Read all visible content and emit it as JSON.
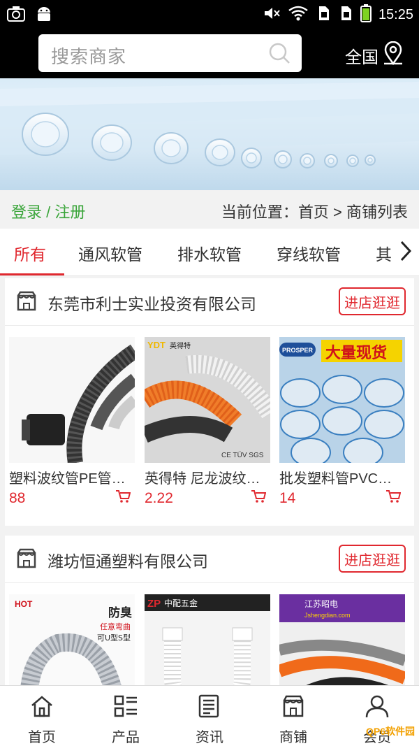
{
  "status_bar": {
    "time": "15:25"
  },
  "header": {
    "search_placeholder": "搜索商家",
    "region": "全国"
  },
  "breadcrumb": {
    "login": "登录 / 注册",
    "location": "当前位置：首页 > 商铺列表"
  },
  "tabs": [
    {
      "label": "所有"
    },
    {
      "label": "通风软管"
    },
    {
      "label": "排水软管"
    },
    {
      "label": "穿线软管"
    },
    {
      "label": "其"
    }
  ],
  "shops": [
    {
      "name": "东莞市利士实业投资有限公司",
      "visit_label": "进店逛逛",
      "products": [
        {
          "name": "塑料波纹管PE管…",
          "price": "88"
        },
        {
          "name": "英得特 尼龙波纹…",
          "price": "2.22",
          "brand": "YDT英得特",
          "badge": "CE TUV SGS"
        },
        {
          "name": "批发塑料管PVC…",
          "price": "14",
          "brand": "PROSPER",
          "headline": "大量现货"
        }
      ]
    },
    {
      "name": "潍坊恒通塑料有限公司",
      "visit_label": "进店逛逛",
      "products": [
        {
          "name": "",
          "price": "",
          "tag": "HOT",
          "headline": "防臭",
          "sub1": "任意弯曲",
          "sub2": "可U型S型"
        },
        {
          "name": "",
          "price": "",
          "brand": "ZP中配五金"
        },
        {
          "name": "",
          "price": "",
          "brand": "江苏昭电",
          "sub1": "Jshengdian.com"
        }
      ]
    }
  ],
  "bottom_nav": [
    {
      "label": "首页",
      "icon": "home-icon"
    },
    {
      "label": "产品",
      "icon": "grid-list-icon"
    },
    {
      "label": "资讯",
      "icon": "news-icon"
    },
    {
      "label": "商铺",
      "icon": "store-icon"
    },
    {
      "label": "会员",
      "icon": "user-icon"
    }
  ],
  "watermark": "QP6软件园",
  "colors": {
    "accent": "#e0282f",
    "login_green": "#3aa53a",
    "header_bg": "#000000"
  }
}
